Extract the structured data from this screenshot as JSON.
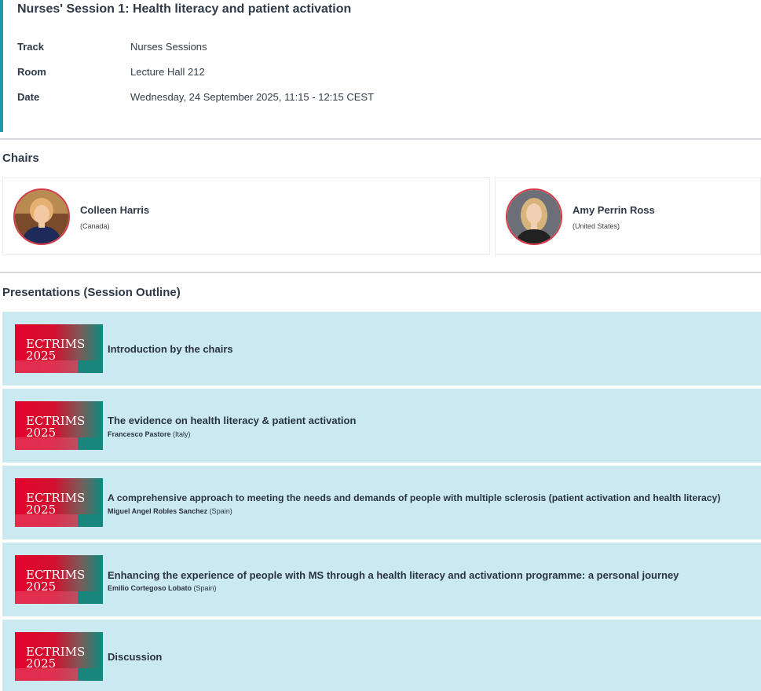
{
  "session": {
    "title": "Nurses' Session 1: Health literacy and patient activation",
    "meta": [
      {
        "label": "Track",
        "value": "Nurses Sessions"
      },
      {
        "label": "Room",
        "value": "Lecture Hall 212"
      },
      {
        "label": "Date",
        "value": "Wednesday, 24 September 2025, 11:15 - 12:15 CEST"
      }
    ]
  },
  "chairs": {
    "heading": "Chairs",
    "items": [
      {
        "name": "Colleen Harris",
        "country": "(Canada)"
      },
      {
        "name": "Amy Perrin Ross",
        "country": "(United States)"
      }
    ]
  },
  "presentations": {
    "heading": "Presentations (Session Outline)",
    "thumb_text_line1": "ECTRIMS",
    "thumb_text_line2": "2025",
    "items": [
      {
        "title": "Introduction by the chairs",
        "speaker": "",
        "country": ""
      },
      {
        "title": "The evidence on health literacy & patient activation",
        "speaker": "Francesco Pastore",
        "country": " (Italy)"
      },
      {
        "title": "A comprehensive approach to meeting the needs and demands of people with multiple sclerosis (patient activation and health literacy)",
        "speaker": "Miguel Angel Robles Sanchez",
        "country": " (Spain)"
      },
      {
        "title": "Enhancing the experience of people with MS through a health literacy and activationn programme: a personal journey",
        "speaker": "Emilio Cortegoso Lobato",
        "country": " (Spain)"
      },
      {
        "title": "Discussion",
        "speaker": "",
        "country": ""
      }
    ]
  },
  "colors": {
    "accent_border": "#1d9aa8",
    "row_background": "#cbe9f1",
    "avatar_border": "#d23b4a",
    "ectrims_red": "#e4032e",
    "ectrims_teal": "#0a8b7e"
  }
}
